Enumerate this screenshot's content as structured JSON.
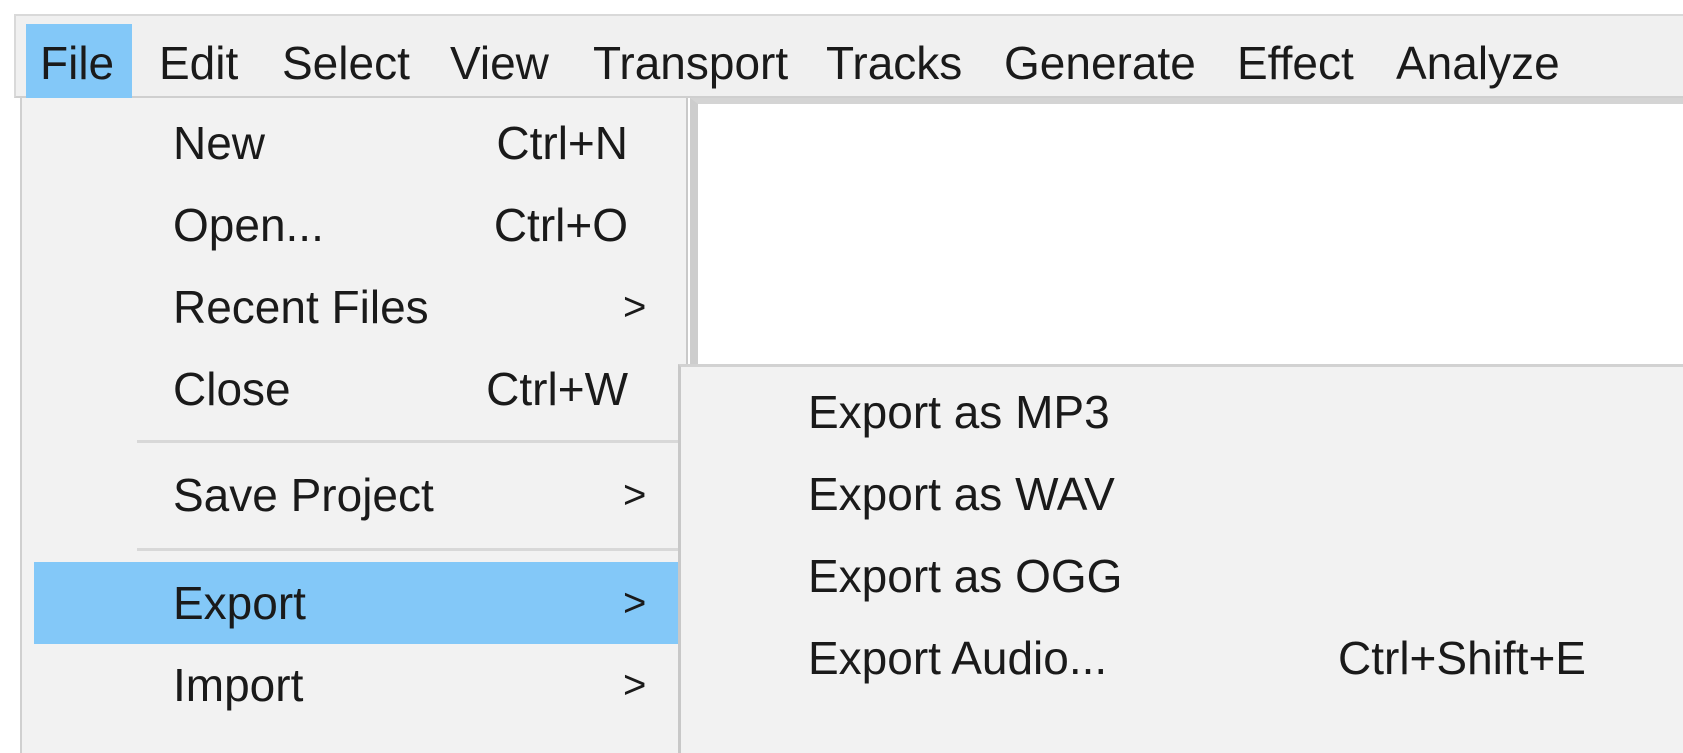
{
  "menubar": {
    "items": [
      {
        "label": "File",
        "active": true
      },
      {
        "label": "Edit"
      },
      {
        "label": "Select"
      },
      {
        "label": "View"
      },
      {
        "label": "Transport"
      },
      {
        "label": "Tracks"
      },
      {
        "label": "Generate"
      },
      {
        "label": "Effect"
      },
      {
        "label": "Analyze"
      }
    ]
  },
  "file_menu": {
    "items": [
      {
        "label": "New",
        "shortcut": "Ctrl+N"
      },
      {
        "label": "Open...",
        "shortcut": "Ctrl+O"
      },
      {
        "label": "Recent Files",
        "submenu_arrow": ">"
      },
      {
        "label": "Close",
        "shortcut": "Ctrl+W"
      },
      {
        "label": "Save Project",
        "submenu_arrow": ">"
      },
      {
        "label": "Export",
        "submenu_arrow": ">",
        "highlighted": true
      },
      {
        "label": "Import",
        "submenu_arrow": ">"
      }
    ]
  },
  "export_submenu": {
    "items": [
      {
        "label": "Export as MP3"
      },
      {
        "label": "Export as WAV"
      },
      {
        "label": "Export as OGG"
      },
      {
        "label": "Export Audio...",
        "shortcut": "Ctrl+Shift+E"
      }
    ]
  },
  "colors": {
    "highlight": "#83c8f8",
    "menu_background": "#f2f2f2",
    "track_area": "#ffffff"
  }
}
